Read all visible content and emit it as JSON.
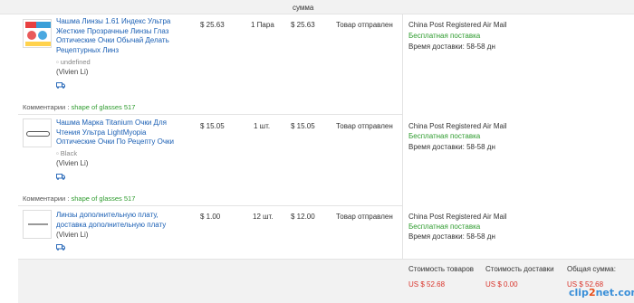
{
  "header": {
    "sum_col": "сумма"
  },
  "orders": [
    {
      "title": "Чашма Линзы 1.61 Индекс Ультра Жесткие Прозрачные Линзы Глаз Оптические Очки Обычай Делать Рецептурных Линз",
      "attr": "undefined",
      "buyer": "(Vivien Li)",
      "price": "$ 25.63",
      "qty": "1 Пара",
      "amount": "$ 25.63",
      "status": "Товар отправлен",
      "shipping": {
        "name": "China Post Registered Air Mail",
        "free": "Бесплатная поставка",
        "time": "Время доставки:  58-58 дн"
      },
      "comment_label": "Комментарии :",
      "comment_value": "shape of glasses 517"
    },
    {
      "title": "Чашма Марка Titanium Очки Для Чтения Ультра LightMyopia Оптические Очки По Рецепту Очки",
      "attr": "Black",
      "buyer": "(Vivien Li)",
      "price": "$ 15.05",
      "qty": "1 шт.",
      "amount": "$ 15.05",
      "status": "Товар отправлен",
      "shipping": {
        "name": "China Post Registered Air Mail",
        "free": "Бесплатная поставка",
        "time": "Время доставки:  58-58 дн"
      },
      "comment_label": "Комментарии :",
      "comment_value": "shape of glasses 517"
    },
    {
      "title": "Линзы дополнительную плату, доставка дополнительную плату",
      "attr": "",
      "buyer": "(Vivien Li)",
      "price": "$ 1.00",
      "qty": "12 шт.",
      "amount": "$ 12.00",
      "status": "Товар отправлен",
      "shipping": {
        "name": "China Post Registered Air Mail",
        "free": "Бесплатная поставка",
        "time": "Время доставки:  58-58 дн"
      }
    }
  ],
  "summary": {
    "goods_label": "Стоимость товаров",
    "goods_value": "US $ 52.68",
    "delivery_label": "Стоимость доставки",
    "delivery_value": "US $ 0.00",
    "total_label": "Общая сумма:",
    "total_value": "US $ 52.68"
  },
  "watermark": {
    "left": "clip",
    "mid": "2",
    "right": "net.com"
  },
  "colors": {
    "link": "#1a5fb4",
    "free": "#2e9b2e",
    "price_red": "#d9342b",
    "panel": "#f2f2f2"
  },
  "icons": {
    "shipping": "truck-icon"
  }
}
